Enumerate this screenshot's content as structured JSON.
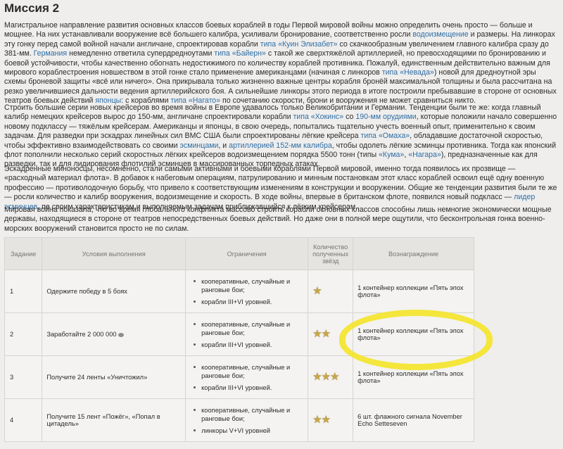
{
  "title": "Миссия 2",
  "p1": {
    "a": "Магистральное направление развития основных классов боевых кораблей в годы Первой мировой войны можно определить очень просто — больше и мощнее. На них устанавливали вооружение всё большего калибра, усиливали бронирование, соответственно росли ",
    "l1": "водоизмещение",
    "b": " и размеры. На линкорах эту гонку перед самой войной начали англичане, спроектировав корабли ",
    "l2": "типа «Куин Элизабет»",
    "c": " со скачкообразным увеличением главного калибра сразу до 381-мм. ",
    "l3": "Германия",
    "d": " немедленно ответила супердредноутами ",
    "l4": "типа «Байерн»",
    "e": " с такой же сверхтяжёлой артиллерией, но превосходящими по бронированию и боевой устойчивости, чтобы качественно обогнать недостижимого по количеству кораблей противника. Пожалуй, единственным действительно важным для мирового кораблестроения новшеством в этой гонке стало применение американцами (начиная с линкоров ",
    "l5": "типа «Невада»",
    "f": ") новой для дредноутной эры схемы броневой защиты «всё или ничего». Она прикрывала только жизненно важные центры корабля бронёй максимальной толщины и была рассчитана на резко увеличившиеся дальности ведения артиллерийского боя. А сильнейшие линкоры этого периода в итоге построили пребывавшие в стороне от основных театров боевых действий ",
    "l6": "японцы",
    "g": ": с кораблями ",
    "l7": "типа «Нагато»",
    "h": " по сочетанию скорости, брони и вооружения не может сравниться никто."
  },
  "p2": {
    "a": "Строить большие серии новых крейсеров во время войны в Европе удавалось только Великобритании и Германии. Тенденции были те же: когда главный калибр немецких крейсеров вырос до 150-мм, англичане спроектировали корабли ",
    "l1": "типа «Хокинс»",
    "b": " со ",
    "l2": "190-мм орудиями",
    "c": ", которые положили начало совершенно новому подклассу — тяжёлым крейсерам. Американцы и японцы, в свою очередь, попытались тщательно учесть военный опыт, применительно к своим задачам. Для разведки при эскадрах линейных сил ВМС США были спроектированы лёгкие крейсера ",
    "l3": "типа «Омаха»",
    "d": ", обладавшие достаточной скоростью, чтобы эффективно взаимодействовать со своими ",
    "l4": "эсминцами",
    "e": ", и ",
    "l5": "артиллерией 152-мм калибра",
    "f": ", чтобы одолеть лёгкие эсминцы противника. Тогда как японский флот пополнили несколько серий скоростных лёгких крейсеров водоизмещением порядка 5500 тонн (типы ",
    "l6": "«Кума»",
    "g": ", ",
    "l7": "«Нагара»",
    "h": "), предназначенные как для разведки, так и для лидирования флотилий эсминцев в массированных торпедных атаках."
  },
  "p3": {
    "a": "Эскадренные миноносцы, несомненно, стали самыми активными и боевыми кораблями Первой мировой, именно тогда появилось их прозвище — «расходный материал флота». В добавок к набеговым операциям, патрулированию и минным постановкам этот класс кораблей освоил ещё одну военную профессию — противолодочную борьбу, что привело к соответствующим изменениям в конструкции и вооружении. Общие же тенденции развития были те же — росли количество и калибр вооружения, водоизмещение и скорость. В ходе войны, впервые в британском флоте, появился новый подкласс — ",
    "l1": "лидер эсминцев",
    "b": ", по своим характеристикам и выполняемым задачам приближавшийся к лёгким крейсерам."
  },
  "p4": "Мировая война показала, что во время глобального конфликта массово строить корабли основных классов способны лишь немногие экономически мощные державы, находящиеся в стороне от театров непосредственных боевых действий. Но даже они в полной мере ощутили, что бесконтрольная гонка военно-морских вооружений становится просто не по силам.",
  "table": {
    "headers": [
      "Задание",
      "Условия выполнения",
      "Ограничения",
      "Количество полученных звёзд",
      "Вознаграждение"
    ],
    "rows": [
      {
        "num": "1",
        "cond": "Одержите победу в 5 боях",
        "lim1": "кооперативные, случайные и ранговые бои;",
        "lim2": "корабли III+VI уровней.",
        "stars": 1,
        "reward": "1 контейнер коллекции «Пять эпох флота»"
      },
      {
        "num": "2",
        "cond": "Заработайте 2 000 000",
        "lim1": "кооперативные, случайные и ранговые бои;",
        "lim2": "корабли III+VI уровней.",
        "stars": 2,
        "reward": "1 контейнер коллекции «Пять эпох флота»"
      },
      {
        "num": "3",
        "cond": "Получите 24 ленты «Уничтожил»",
        "lim1": "кооперативные, случайные и ранговые бои;",
        "lim2": "корабли III+VI уровней.",
        "stars": 3,
        "reward": "1 контейнер коллекции «Пять эпох флота»"
      },
      {
        "num": "4",
        "cond": "Получите 15 лент «Пожёг», «Попал в цитадель»",
        "lim1": "кооперативные, случайные и ранговые бои;",
        "lim2": "линкоры V+VI уровней",
        "stars": 2,
        "reward": "6 шт. флажного сигнала November Echo Setteseven"
      }
    ]
  },
  "colors": {
    "link": "#2f6ea4",
    "star": "#c8a646",
    "highlight": "#f3e531",
    "background": "#efeeed"
  }
}
